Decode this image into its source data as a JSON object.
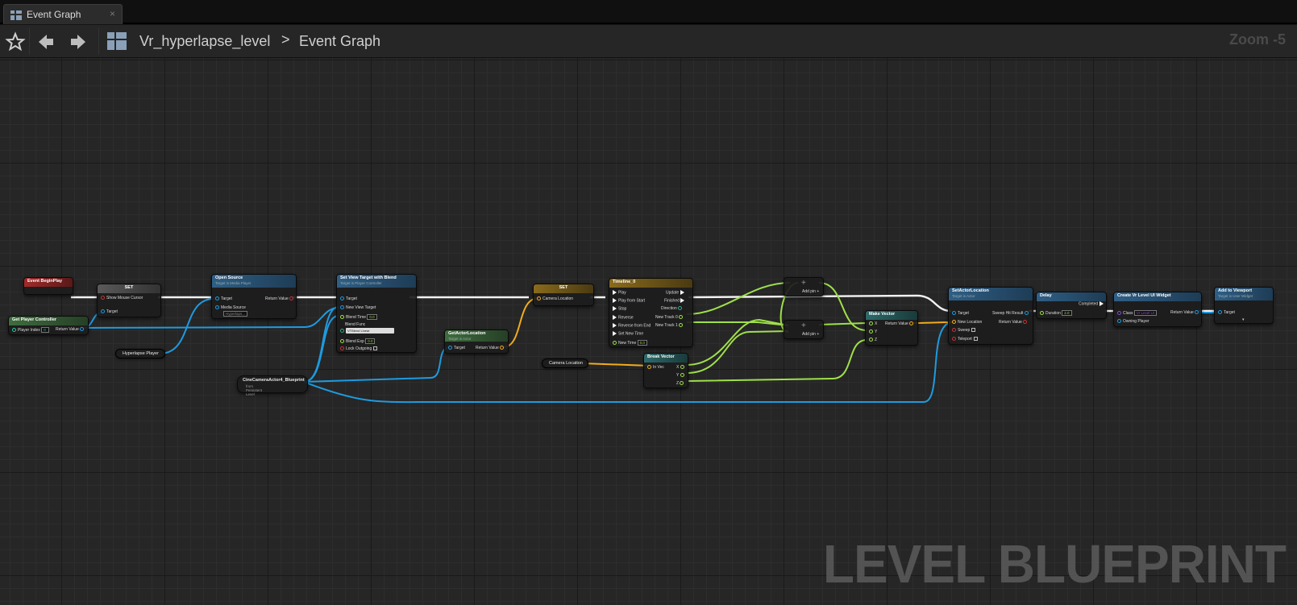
{
  "tab": {
    "label": "Event Graph",
    "close": "×"
  },
  "breadcrumb": {
    "level": "Vr_hyperlapse_level",
    "separator": ">",
    "graph": "Event Graph"
  },
  "zoom_label": "Zoom -5",
  "watermark": "LEVEL BLUEPRINT",
  "colors": {
    "exec": "#ffffff",
    "object": "#1e9be0",
    "struct": "#f0ad1e",
    "float": "#9fe04a",
    "event": "#a32a2a",
    "function": "#2f5f86"
  },
  "nodes": {
    "begin_play": {
      "title": "Event BeginPlay"
    },
    "set1": {
      "title": "SET",
      "show_mouse_cursor": "Show Mouse Cursor",
      "target": "Target"
    },
    "get_player_controller": {
      "title": "Get Player Controller",
      "player_index": "Player Index",
      "player_index_val": "0",
      "return_value": "Return Value"
    },
    "open_source": {
      "title": "Open Source",
      "subtitle": "Target is Media Player",
      "target": "Target",
      "media_source": "Media Source",
      "return_value": "Return Value",
      "media_source_val": "Hyperlaps..."
    },
    "hyperlapse_player": {
      "title": "Hyperlapse Player"
    },
    "set_view_target": {
      "title": "Set View Target with Blend",
      "subtitle": "Target is Player Controller",
      "target": "Target",
      "new_view_target": "New View Target",
      "blend_time": "Blend Time",
      "blend_time_val": "0.0",
      "blend_func": "Blend Func",
      "blend_func_val": "VTBlend Linear",
      "blend_exp": "Blend Exp",
      "blend_exp_val": "0.0",
      "lock_outgoing": "Lock Outgoing"
    },
    "cine_camera": {
      "title": "CineCameraActor4_Blueprint",
      "subtitle": "from Persistent Level"
    },
    "get_actor_location": {
      "title": "GetActorLocation",
      "subtitle": "Target is Actor",
      "target": "Target",
      "return_value": "Return Value"
    },
    "set2": {
      "title": "SET",
      "camera_location": "Camera Location"
    },
    "timeline": {
      "title": "Timeline_0",
      "play": "Play",
      "play_from_start": "Play from Start",
      "stop": "Stop",
      "reverse": "Reverse",
      "reverse_from_end": "Reverse from End",
      "set_new_time": "Set New Time",
      "new_time": "New Time",
      "new_time_val": "0.0",
      "update": "Update",
      "finished": "Finished",
      "direction": "Direction",
      "new_track_0": "New Track 0",
      "new_track_1": "New Track 1"
    },
    "camera_location_var": {
      "title": "Camera Location"
    },
    "break_vector": {
      "title": "Break Vector",
      "in_vec": "In Vec",
      "x": "X",
      "y": "Y",
      "z": "Z"
    },
    "add1": {
      "symbol": "+",
      "add_pin": "Add pin"
    },
    "add2": {
      "symbol": "+",
      "add_pin": "Add pin"
    },
    "make_vector": {
      "title": "Make Vector",
      "x": "X",
      "y": "Y",
      "z": "Z",
      "return_value": "Return Value"
    },
    "set_actor_location": {
      "title": "SetActorLocation",
      "subtitle": "Target is Actor",
      "target": "Target",
      "new_location": "New Location",
      "sweep": "Sweep",
      "teleport": "Teleport",
      "sweep_hit_result": "Sweep Hit Result",
      "return_value": "Return Value"
    },
    "delay": {
      "title": "Delay",
      "duration": "Duration",
      "duration_val": "2.0",
      "completed": "Completed"
    },
    "create_widget": {
      "title": "Create Vr Level UI Widget",
      "class": "Class",
      "class_val": "Vr Level UI",
      "owning_player": "Owning Player",
      "return_value": "Return Value"
    },
    "add_to_viewport": {
      "title": "Add to Viewport",
      "subtitle": "Target is User Widget",
      "target": "Target"
    }
  }
}
